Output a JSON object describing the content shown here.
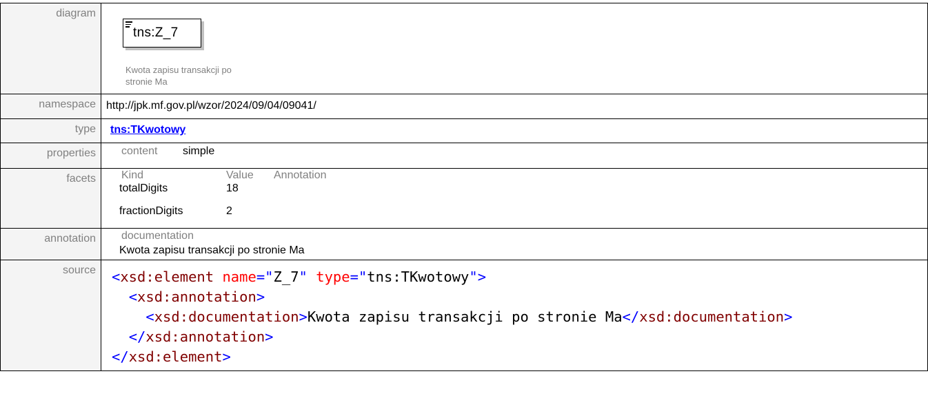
{
  "rows": {
    "diagram": {
      "label": "diagram",
      "element_name": "tns:Z_7",
      "element_description": "Kwota zapisu transakcji po stronie Ma"
    },
    "namespace": {
      "label": "namespace",
      "value": "http://jpk.mf.gov.pl/wzor/2024/09/04/09041/"
    },
    "type": {
      "label": "type",
      "value": "tns:TKwotowy"
    },
    "properties": {
      "label": "properties",
      "items": [
        {
          "name": "content",
          "value": "simple"
        }
      ]
    },
    "facets": {
      "label": "facets",
      "headers": {
        "kind": "Kind",
        "value": "Value",
        "annotation": "Annotation"
      },
      "items": [
        {
          "kind": "totalDigits",
          "value": "18",
          "annotation": ""
        },
        {
          "kind": "fractionDigits",
          "value": "2",
          "annotation": ""
        }
      ]
    },
    "annotation": {
      "label": "annotation",
      "doc_label": "documentation",
      "doc_text": "Kwota zapisu transakcji po stronie Ma"
    },
    "source": {
      "label": "source",
      "lines": {
        "l1_open": "<",
        "l1_tag": "xsd:element",
        "l1_attr1": "name",
        "l1_eq1": "=\"",
        "l1_val1": "Z_7",
        "l1_q1": "\"",
        "l1_attr2": "type",
        "l1_eq2": "=\"",
        "l1_val2": "tns:TKwotowy",
        "l1_q2": "\"",
        "l1_close": ">",
        "l2_open": "<",
        "l2_tag": "xsd:annotation",
        "l2_close": ">",
        "l3_open": "<",
        "l3_tag": "xsd:documentation",
        "l3_close": ">",
        "l3_text": "Kwota zapisu transakcji po stronie Ma",
        "l3_open2": "</",
        "l3_tag2": "xsd:documentation",
        "l3_close2": ">",
        "l4_open": "</",
        "l4_tag": "xsd:annotation",
        "l4_close": ">",
        "l5_open": "</",
        "l5_tag": "xsd:element",
        "l5_close": ">"
      }
    }
  },
  "colors": {
    "label_text": "#808080",
    "label_bg": "#f4f4f4",
    "link": "#0000ff",
    "xml_tag": "#800000",
    "xml_bracket": "#0000ff",
    "xml_attr": "#ff0000"
  }
}
